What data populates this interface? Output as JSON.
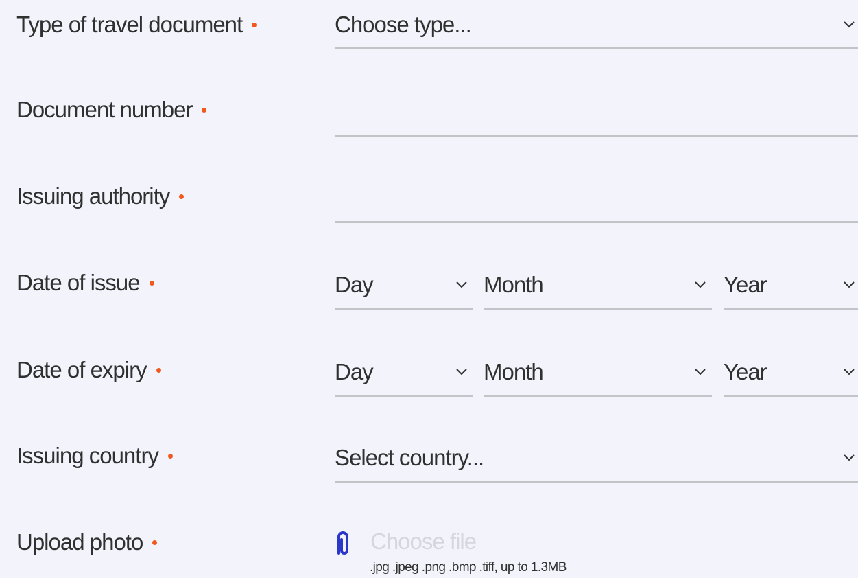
{
  "colors": {
    "background": "#f3f3fb",
    "text": "#303030",
    "required_dot": "#f05a1c",
    "underline": "#c4c4c8",
    "upload_icon": "#2b37c9",
    "placeholder_faint": "#d6d6df"
  },
  "form": {
    "travel_document_type": {
      "label": "Type of travel document",
      "placeholder": "Choose type..."
    },
    "document_number": {
      "label": "Document number",
      "value": ""
    },
    "issuing_authority": {
      "label": "Issuing authority",
      "value": ""
    },
    "date_of_issue": {
      "label": "Date of issue",
      "day": "Day",
      "month": "Month",
      "year": "Year"
    },
    "date_of_expiry": {
      "label": "Date of expiry",
      "day": "Day",
      "month": "Month",
      "year": "Year"
    },
    "issuing_country": {
      "label": "Issuing country",
      "placeholder": "Select country..."
    },
    "upload_photo": {
      "label": "Upload photo",
      "button": "Choose file",
      "hint": ".jpg .jpeg .png .bmp .tiff, up to 1.3MB",
      "icon": "paperclip-icon"
    }
  },
  "icons": {
    "dropdown": "chevron-down-icon",
    "required": "required-dot"
  }
}
